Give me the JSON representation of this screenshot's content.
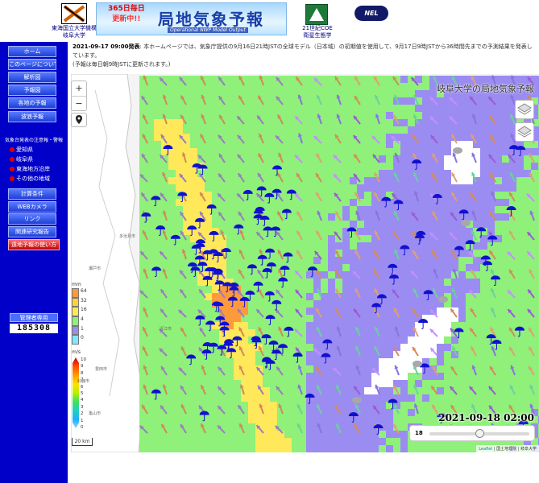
{
  "header": {
    "logo_caption_line1": "東海国立大学機構",
    "logo_caption_line2": "岐阜大学",
    "banner_badge_line1": "365日毎日",
    "banner_badge_line2": "更新中!!",
    "banner_title": "局地気象予報",
    "banner_subtitle": "Operational NWP Model Output",
    "coe_caption_line1": "21世紀COE",
    "coe_caption_line2": "衛星生態学",
    "nel_logo_text": "NEL"
  },
  "nav": {
    "items": [
      "ホーム",
      "このページについて",
      "解析図",
      "予報図",
      "各地の予報",
      "波浪予報"
    ],
    "warnings_title": "気象台発表の注意報・警報",
    "warning_links": [
      "愛知県",
      "岐阜県",
      "東海地方沿岸",
      "その他の地域"
    ],
    "items2": [
      "計算条件",
      "WEBカメラ",
      "リンク",
      "関連研究報告"
    ],
    "red_button": "遠地予報の使い方",
    "counter_label": "管理者専用",
    "counter_value": "185308"
  },
  "info": {
    "date": "2021-09-17 09:00",
    "date_suffix": "発表",
    "text": ": 本ホームページでは、気象庁提供の9月16日21時JSTの全球モデル（日本域）の初期値を使用して、9月17日9時JSTから36時間先までの予測結果を発表しています。",
    "text2": "(予報は毎日朝9時JSTに更新されます。)"
  },
  "map": {
    "zoom_in": "+",
    "zoom_out": "−",
    "watermark": "岐阜大学の局地気象予報",
    "timestamp": "2021-09-18 02:00",
    "slider_value": "18",
    "slider_fraction": 0.5,
    "attribution_leaflet": "Leaflet",
    "attribution_rest": " | 国土地理院 | 岐阜大学",
    "scale_label": "20 km",
    "precip_unit": "mm",
    "precip_ticks": [
      "64",
      "32",
      "16",
      "4",
      "1",
      "0"
    ],
    "wind_unit": "m/s",
    "wind_ticks": [
      "10",
      "9",
      "8",
      "7",
      "6",
      "5",
      "4",
      "3",
      "2",
      "1",
      "0"
    ],
    "place_labels": [
      "多治見市",
      "瀬戸市",
      "豊田市",
      "鈴鹿市",
      "亀山市",
      "近江市"
    ]
  },
  "colors": {
    "nav_blue": "#0000c8",
    "rain_heavy": "#ff9a3c",
    "rain_mid": "#ffe85a",
    "rain_low": "#8ff07a",
    "rain_light": "#9b8cf2",
    "rain_trace": "#ffffff",
    "umbrella": "#1010d0"
  }
}
